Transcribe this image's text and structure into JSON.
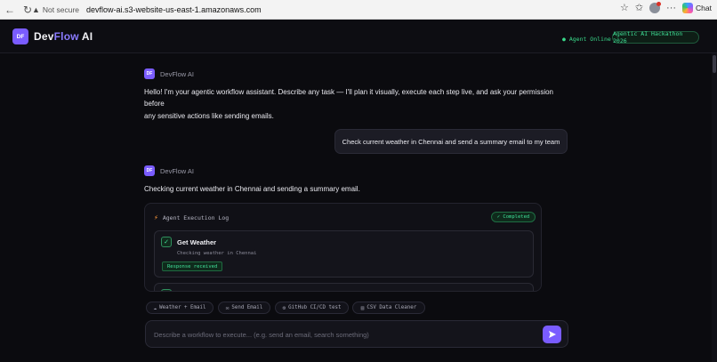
{
  "browser": {
    "security_label": "Not secure",
    "url": "devflow-ai.s3-website-us-east-1.amazonaws.com",
    "chat_label": "Chat"
  },
  "header": {
    "logo_badge": "DF",
    "logo_part1": "Dev",
    "logo_part2": "Flow",
    "logo_part3": " AI",
    "status": "● Agent Online",
    "event_badge": "Agentic AI Hackathon 2026"
  },
  "messages": {
    "bot_avatar": "DF",
    "bot_name": "DevFlow AI",
    "greeting_line1": "Hello! I'm your agentic workflow assistant. Describe any task — I'll plan it visually, execute each step live, and ask your permission before",
    "greeting_line2": "any sensitive actions like sending emails.",
    "user_message": "Check current weather in Chennai and send a summary email to my team",
    "reply": "Checking current weather in Chennai and sending a summary email."
  },
  "execution_log": {
    "title": "Agent Execution Log",
    "status": "✓ Completed",
    "steps": [
      {
        "title": "Get Weather",
        "detail": "Checking weather in Chennai",
        "result": "Response received"
      }
    ]
  },
  "quick_actions": [
    {
      "icon": "☁",
      "label": "Weather + Email"
    },
    {
      "icon": "✉",
      "label": "Send Email"
    },
    {
      "icon": "⚙",
      "label": "GitHub CI/CD test"
    },
    {
      "icon": "▤",
      "label": "CSV Data Cleaner"
    }
  ],
  "composer": {
    "placeholder": "Describe a workflow to execute... (e.g. send an email, search something)"
  },
  "colors": {
    "accent": "#7a5cff",
    "success": "#3fe098",
    "background": "#0b0b0f"
  }
}
